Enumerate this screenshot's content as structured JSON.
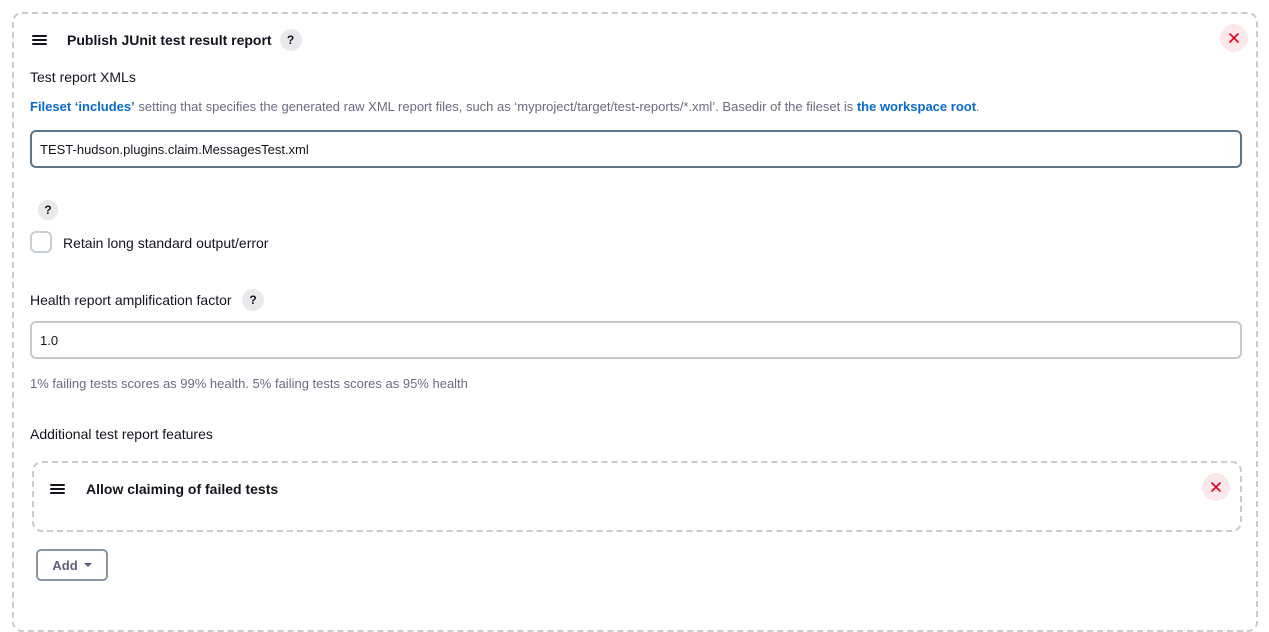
{
  "step": {
    "title": "Publish JUnit test result report",
    "help_icon": "question-mark-icon",
    "drag_icon": "drag-handle-icon",
    "close_icon": "close-icon",
    "test_report_xmls": {
      "label": "Test report XMLs",
      "description": {
        "link1": "Fileset ‘includes’",
        "text": " setting that specifies the generated raw XML report files, such as ‘myproject/target/test-reports/*.xml’. Basedir of the fileset is ",
        "link2": "the workspace root",
        "end": "."
      },
      "value": "TEST-hudson.plugins.claim.MessagesTest.xml"
    },
    "retain_output": {
      "label": "Retain long standard output/error",
      "checked": false
    },
    "health_factor": {
      "label": "Health report amplification factor",
      "value": "1.0",
      "hint": "1% failing tests scores as 99% health. 5% failing tests scores as 95% health"
    },
    "additional_features": {
      "label": "Additional test report features",
      "items": [
        {
          "title": "Allow claiming of failed tests"
        }
      ],
      "add_button": "Add"
    }
  },
  "colors": {
    "link": "#0b6bcb",
    "close_bg": "#fce8ea",
    "close_fg": "#e6001f",
    "dashed_border": "#c7ccd1"
  }
}
